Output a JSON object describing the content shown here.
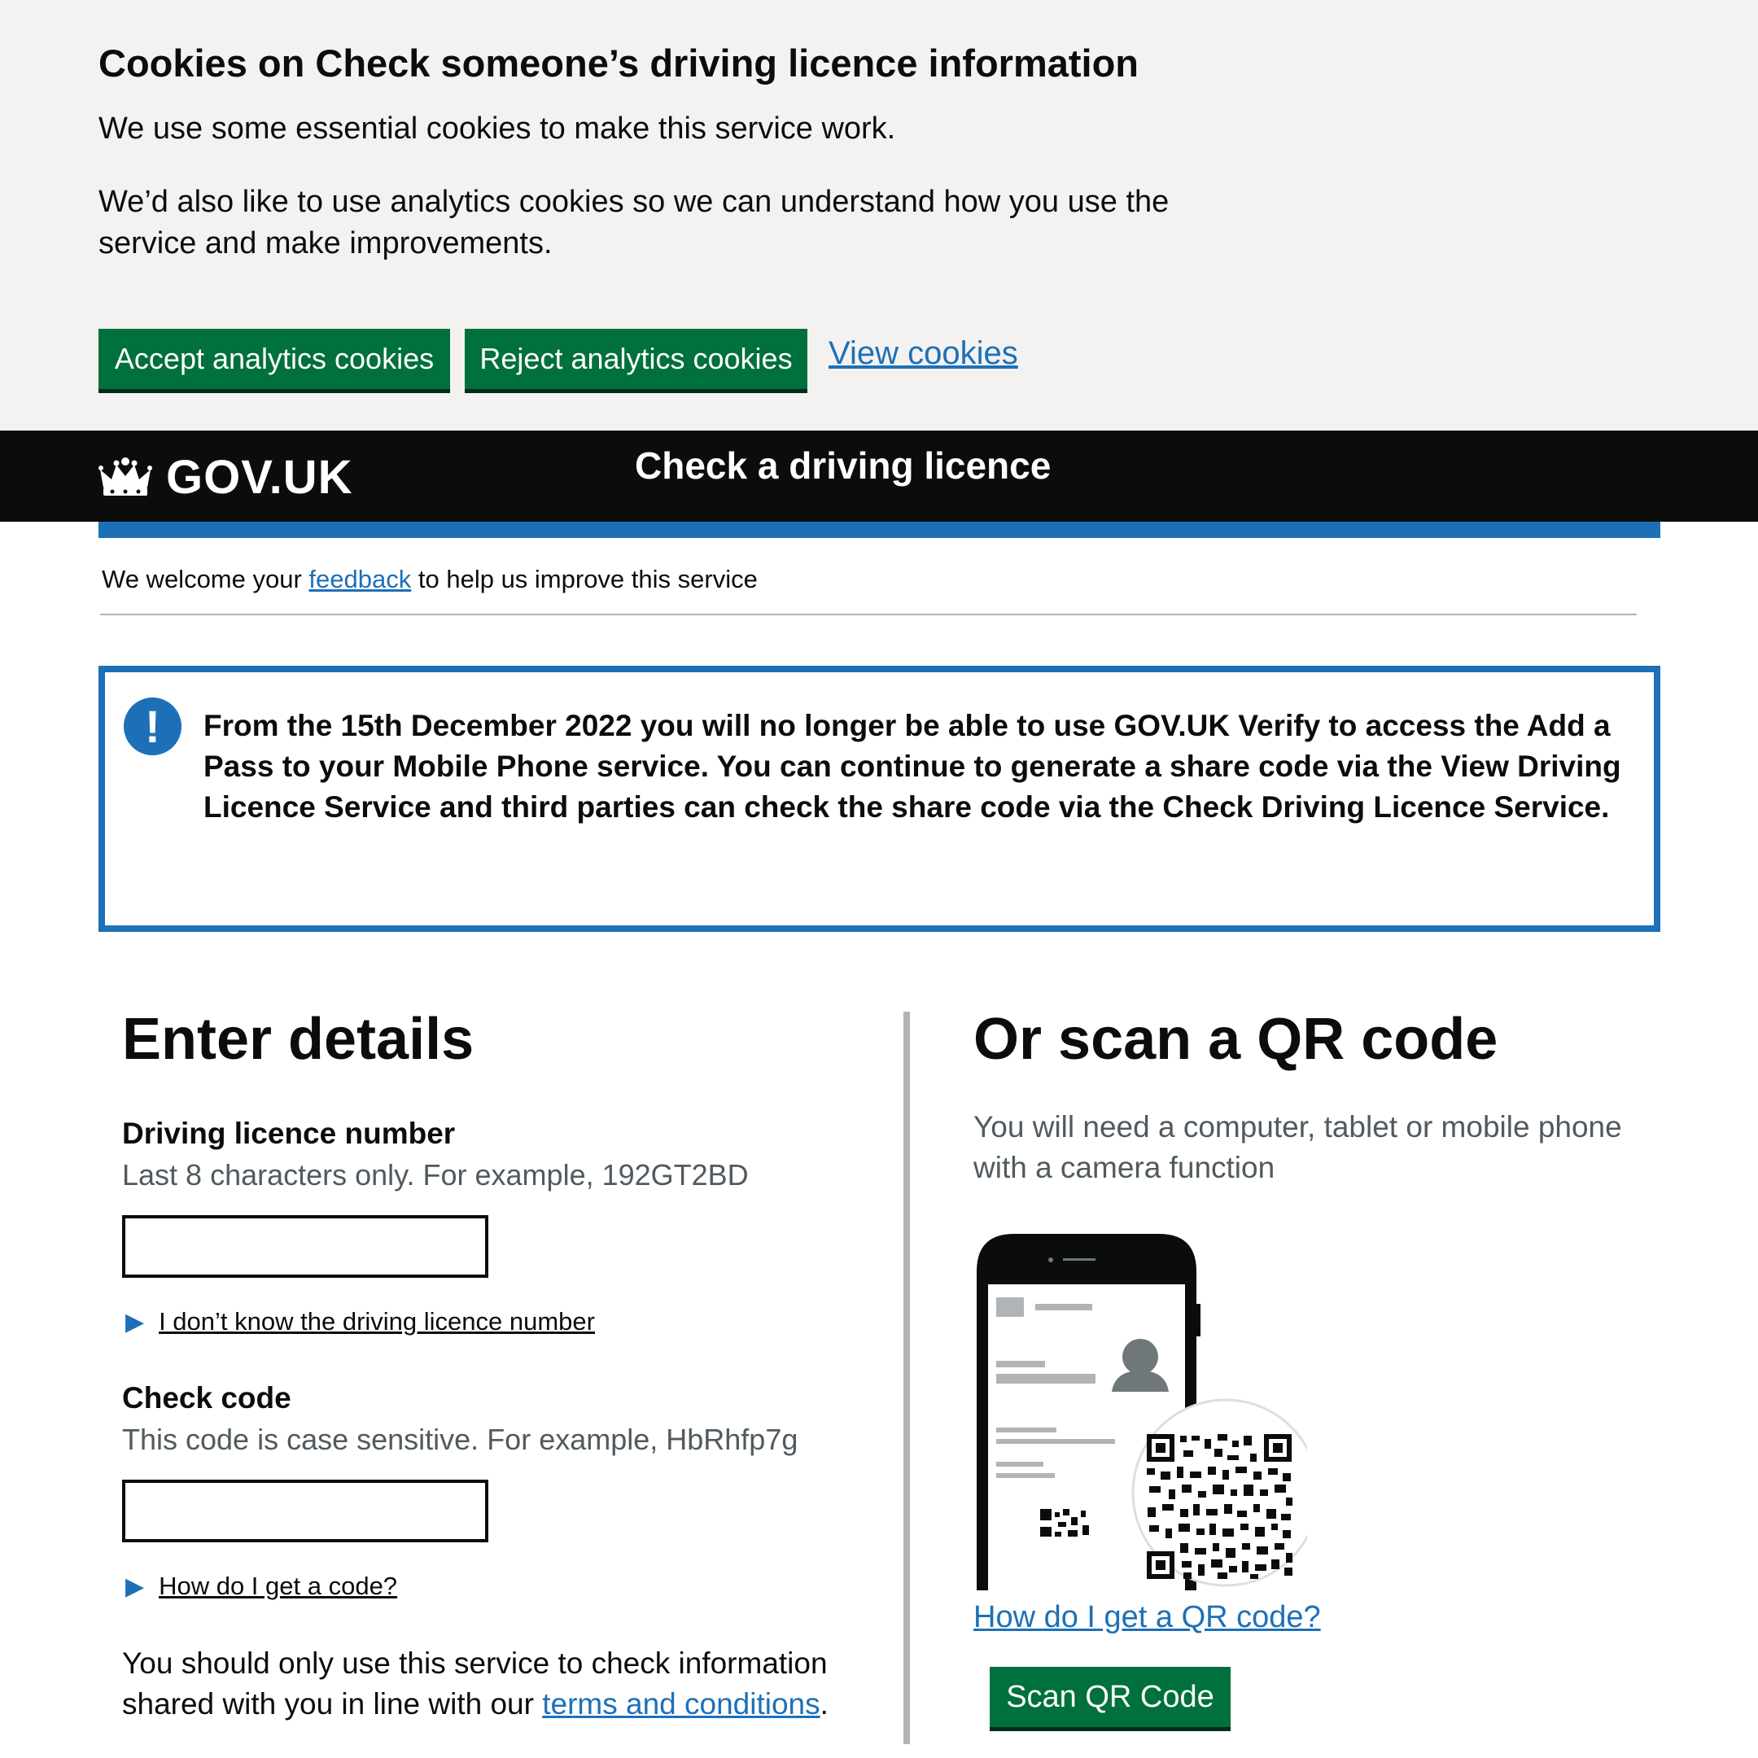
{
  "cookie_banner": {
    "title": "Cookies on Check someone’s driving licence information",
    "para1": "We use some essential cookies to make this service work.",
    "para2": "We’d also like to use analytics cookies so we can understand how you use the service and make improvements.",
    "accept_label": "Accept analytics cookies",
    "reject_label": "Reject analytics cookies",
    "view_label": "View cookies"
  },
  "header": {
    "logo_text": "GOV.UK",
    "service_name": "Check a driving licence"
  },
  "feedback": {
    "before": "We welcome your",
    "link": "feedback",
    "after": "to help us improve this service"
  },
  "notice": {
    "icon": "!",
    "text": "From the 15th December 2022 you will no longer be able to use GOV.UK Verify to access the Add a Pass to your Mobile Phone service. You can continue to generate a share code via the View Driving Licence Service and third parties can check the share code via the Check Driving Licence Service."
  },
  "enter_details": {
    "heading": "Enter details",
    "licence_label": "Driving licence number",
    "licence_hint": "Last 8 characters only. For example, 192GT2BD",
    "licence_value": "",
    "licence_help": "I don’t know the driving licence number",
    "code_label": "Check code",
    "code_hint": "This code is case sensitive. For example, HbRhfp7g",
    "code_value": "",
    "code_help": "How do I get a code?",
    "terms_before": "You should only use this service to check information shared with you in line with our",
    "terms_link": "terms and conditions",
    "terms_after": "."
  },
  "scan_qr": {
    "heading": "Or scan a QR code",
    "hint": "You will need a computer, tablet or mobile phone with a camera function",
    "help_link": "How do I get a QR code?",
    "button_label": "Scan QR Code"
  },
  "colors": {
    "button_green": "#00703c",
    "link_blue": "#1d70b8",
    "header_black": "#0b0c0c",
    "banner_grey": "#f3f2f1"
  },
  "icons": {
    "crown": "crown-icon",
    "notice": "exclamation-icon",
    "details_toggle": "triangle-right-icon"
  }
}
